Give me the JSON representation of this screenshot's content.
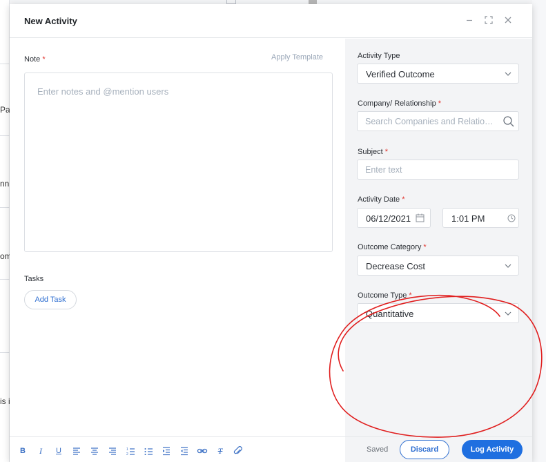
{
  "background": {
    "fragments": [
      "Pa",
      "nn",
      "om",
      "is i"
    ]
  },
  "modal": {
    "title": "New Activity",
    "note": {
      "label": "Note",
      "required_mark": "*",
      "apply_template": "Apply Template",
      "placeholder": "Enter notes and @mention users"
    },
    "tasks": {
      "label": "Tasks",
      "add_task": "Add Task"
    },
    "fields": {
      "activity_type": {
        "label": "Activity Type",
        "value": "Verified Outcome"
      },
      "company": {
        "label": "Company/ Relationship",
        "placeholder": "Search Companies and Relationships"
      },
      "subject": {
        "label": "Subject",
        "placeholder": "Enter text"
      },
      "activity_date": {
        "label": "Activity Date",
        "date": "06/12/2021",
        "time": "1:01 PM"
      },
      "outcome_category": {
        "label": "Outcome Category",
        "value": "Decrease Cost"
      },
      "outcome_type": {
        "label": "Outcome Type",
        "value": "Quantitative"
      }
    },
    "footer": {
      "toolbar": [
        "bold-icon",
        "italic-icon",
        "underline-icon",
        "align-left-icon",
        "align-center-icon",
        "align-right-icon",
        "ordered-list-icon",
        "bullet-list-icon",
        "indent-icon",
        "outdent-icon",
        "link-icon",
        "clear-format-icon",
        "attachment-icon"
      ],
      "saved": "Saved",
      "discard": "Discard",
      "log_activity": "Log Activity"
    }
  },
  "colors": {
    "primary": "#1f6fe0",
    "required": "#e0322b",
    "annotation": "#e01e1e"
  }
}
